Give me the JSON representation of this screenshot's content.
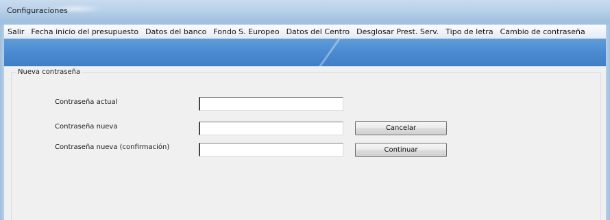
{
  "window": {
    "title": "Configuraciones"
  },
  "menu": {
    "items": [
      "Salir",
      "Fecha inicio del presupuesto",
      "Datos del banco",
      "Fondo S. Europeo",
      "Datos del Centro",
      "Desglosar Prest. Serv.",
      "Tipo de letra",
      "Cambio de contraseña"
    ]
  },
  "password_group": {
    "legend": "Nueva contraseña",
    "current_label": "Contraseña actual",
    "current_value": "",
    "new_label": "Contraseña nueva",
    "new_value": "",
    "confirm_label": "Contraseña nueva (confirmación)",
    "confirm_value": "",
    "cancel_label": "Cancelar",
    "continue_label": "Continuar"
  },
  "colors": {
    "band": "#4b8ad0",
    "titlebar": "#bcd3ea",
    "client": "#f0f0f0"
  }
}
